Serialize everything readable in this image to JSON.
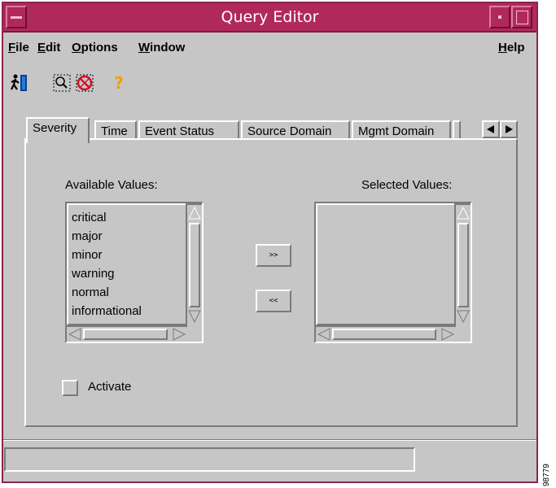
{
  "window": {
    "title": "Query Editor"
  },
  "menubar": {
    "items": [
      {
        "label_rest": "ile",
        "mnemonic": "F",
        "name": "file"
      },
      {
        "label_rest": "dit",
        "mnemonic": "E",
        "name": "edit"
      },
      {
        "label_rest": "ptions",
        "mnemonic": "O",
        "name": "options"
      },
      {
        "label_rest": "indow",
        "mnemonic": "W",
        "name": "window"
      }
    ],
    "help": {
      "mnemonic": "H",
      "label_rest": "elp"
    }
  },
  "toolbar": {
    "icons": [
      "exit-icon",
      "select-area-icon",
      "clear-icon",
      "help-icon"
    ],
    "help_glyph": "?"
  },
  "tabs": [
    {
      "label": "Severity",
      "active": true
    },
    {
      "label": "Time",
      "active": false
    },
    {
      "label": "Event Status",
      "active": false
    },
    {
      "label": "Source Domain",
      "active": false
    },
    {
      "label": "Mgmt Domain",
      "active": false
    }
  ],
  "severity_panel": {
    "available_label": "Available Values:",
    "selected_label": "Selected Values:",
    "available_values": [
      "critical",
      "major",
      "minor",
      "warning",
      "normal",
      "informational"
    ],
    "selected_values": [],
    "add_button": ">>",
    "remove_button": "<<",
    "activate_label": "Activate",
    "activate_checked": false
  },
  "statusbar": {
    "text": ""
  },
  "figure_code": "98779"
}
